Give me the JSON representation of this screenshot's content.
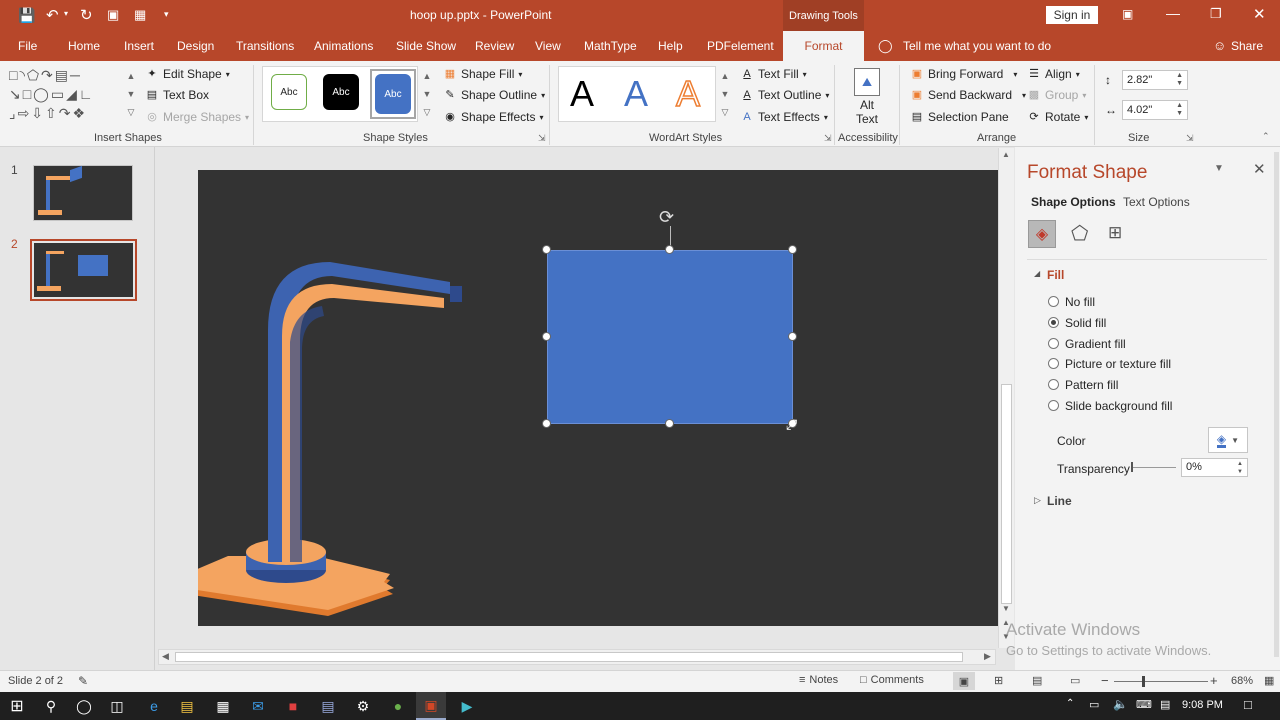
{
  "titlebar": {
    "filename": "hoop up.pptx",
    "separator": "-",
    "app": "PowerPoint",
    "context_tools": "Drawing Tools",
    "sign_in": "Sign in"
  },
  "tabs": [
    "File",
    "Home",
    "Insert",
    "Design",
    "Transitions",
    "Animations",
    "Slide Show",
    "Review",
    "View",
    "MathType",
    "Help",
    "PDFelement",
    "Format"
  ],
  "active_tab": "Format",
  "tell_me": "Tell me what you want to do",
  "share": "Share",
  "ribbon": {
    "insert_shapes": {
      "label": "Insert Shapes",
      "edit_shape": "Edit Shape",
      "text_box": "Text Box",
      "merge_shapes": "Merge Shapes"
    },
    "shape_styles": {
      "label": "Shape Styles",
      "swatches": [
        "Abc",
        "Abc",
        "Abc"
      ],
      "fill": "Shape Fill",
      "outline": "Shape Outline",
      "effects": "Shape Effects"
    },
    "wordart": {
      "label": "WordArt Styles",
      "letters": [
        "A",
        "A",
        "A"
      ],
      "fill": "Text Fill",
      "outline": "Text Outline",
      "effects": "Text Effects"
    },
    "accessibility": {
      "label": "Accessibility",
      "alt_text_1": "Alt",
      "alt_text_2": "Text"
    },
    "arrange": {
      "label": "Arrange",
      "bring_forward": "Bring Forward",
      "send_backward": "Send Backward",
      "selection_pane": "Selection Pane",
      "align": "Align",
      "group": "Group",
      "rotate": "Rotate"
    },
    "size": {
      "label": "Size",
      "height": "2.82\"",
      "width": "4.02\""
    }
  },
  "slides": [
    {
      "number": "1"
    },
    {
      "number": "2"
    }
  ],
  "format_shape": {
    "title": "Format Shape",
    "tab_shape_options": "Shape Options",
    "tab_text_options": "Text Options",
    "fill_header": "Fill",
    "fill_options": [
      "No fill",
      "Solid fill",
      "Gradient fill",
      "Picture or texture fill",
      "Pattern fill",
      "Slide background fill"
    ],
    "selected_fill": "Solid fill",
    "color_label": "Color",
    "transparency_label": "Transparency",
    "transparency_value": "0%",
    "line_header": "Line"
  },
  "watermark": {
    "line1": "Activate Windows",
    "line2": "Go to Settings to activate Windows."
  },
  "status": {
    "slide_info": "Slide 2 of 2",
    "notes": "Notes",
    "comments": "Comments",
    "zoom": "68%"
  },
  "taskbar": {
    "time": "9:08 PM"
  },
  "colors": {
    "accent": "#b7472a",
    "shape_fill": "#4472c4",
    "slide_bg": "#333333",
    "orange": "#f4a460"
  }
}
